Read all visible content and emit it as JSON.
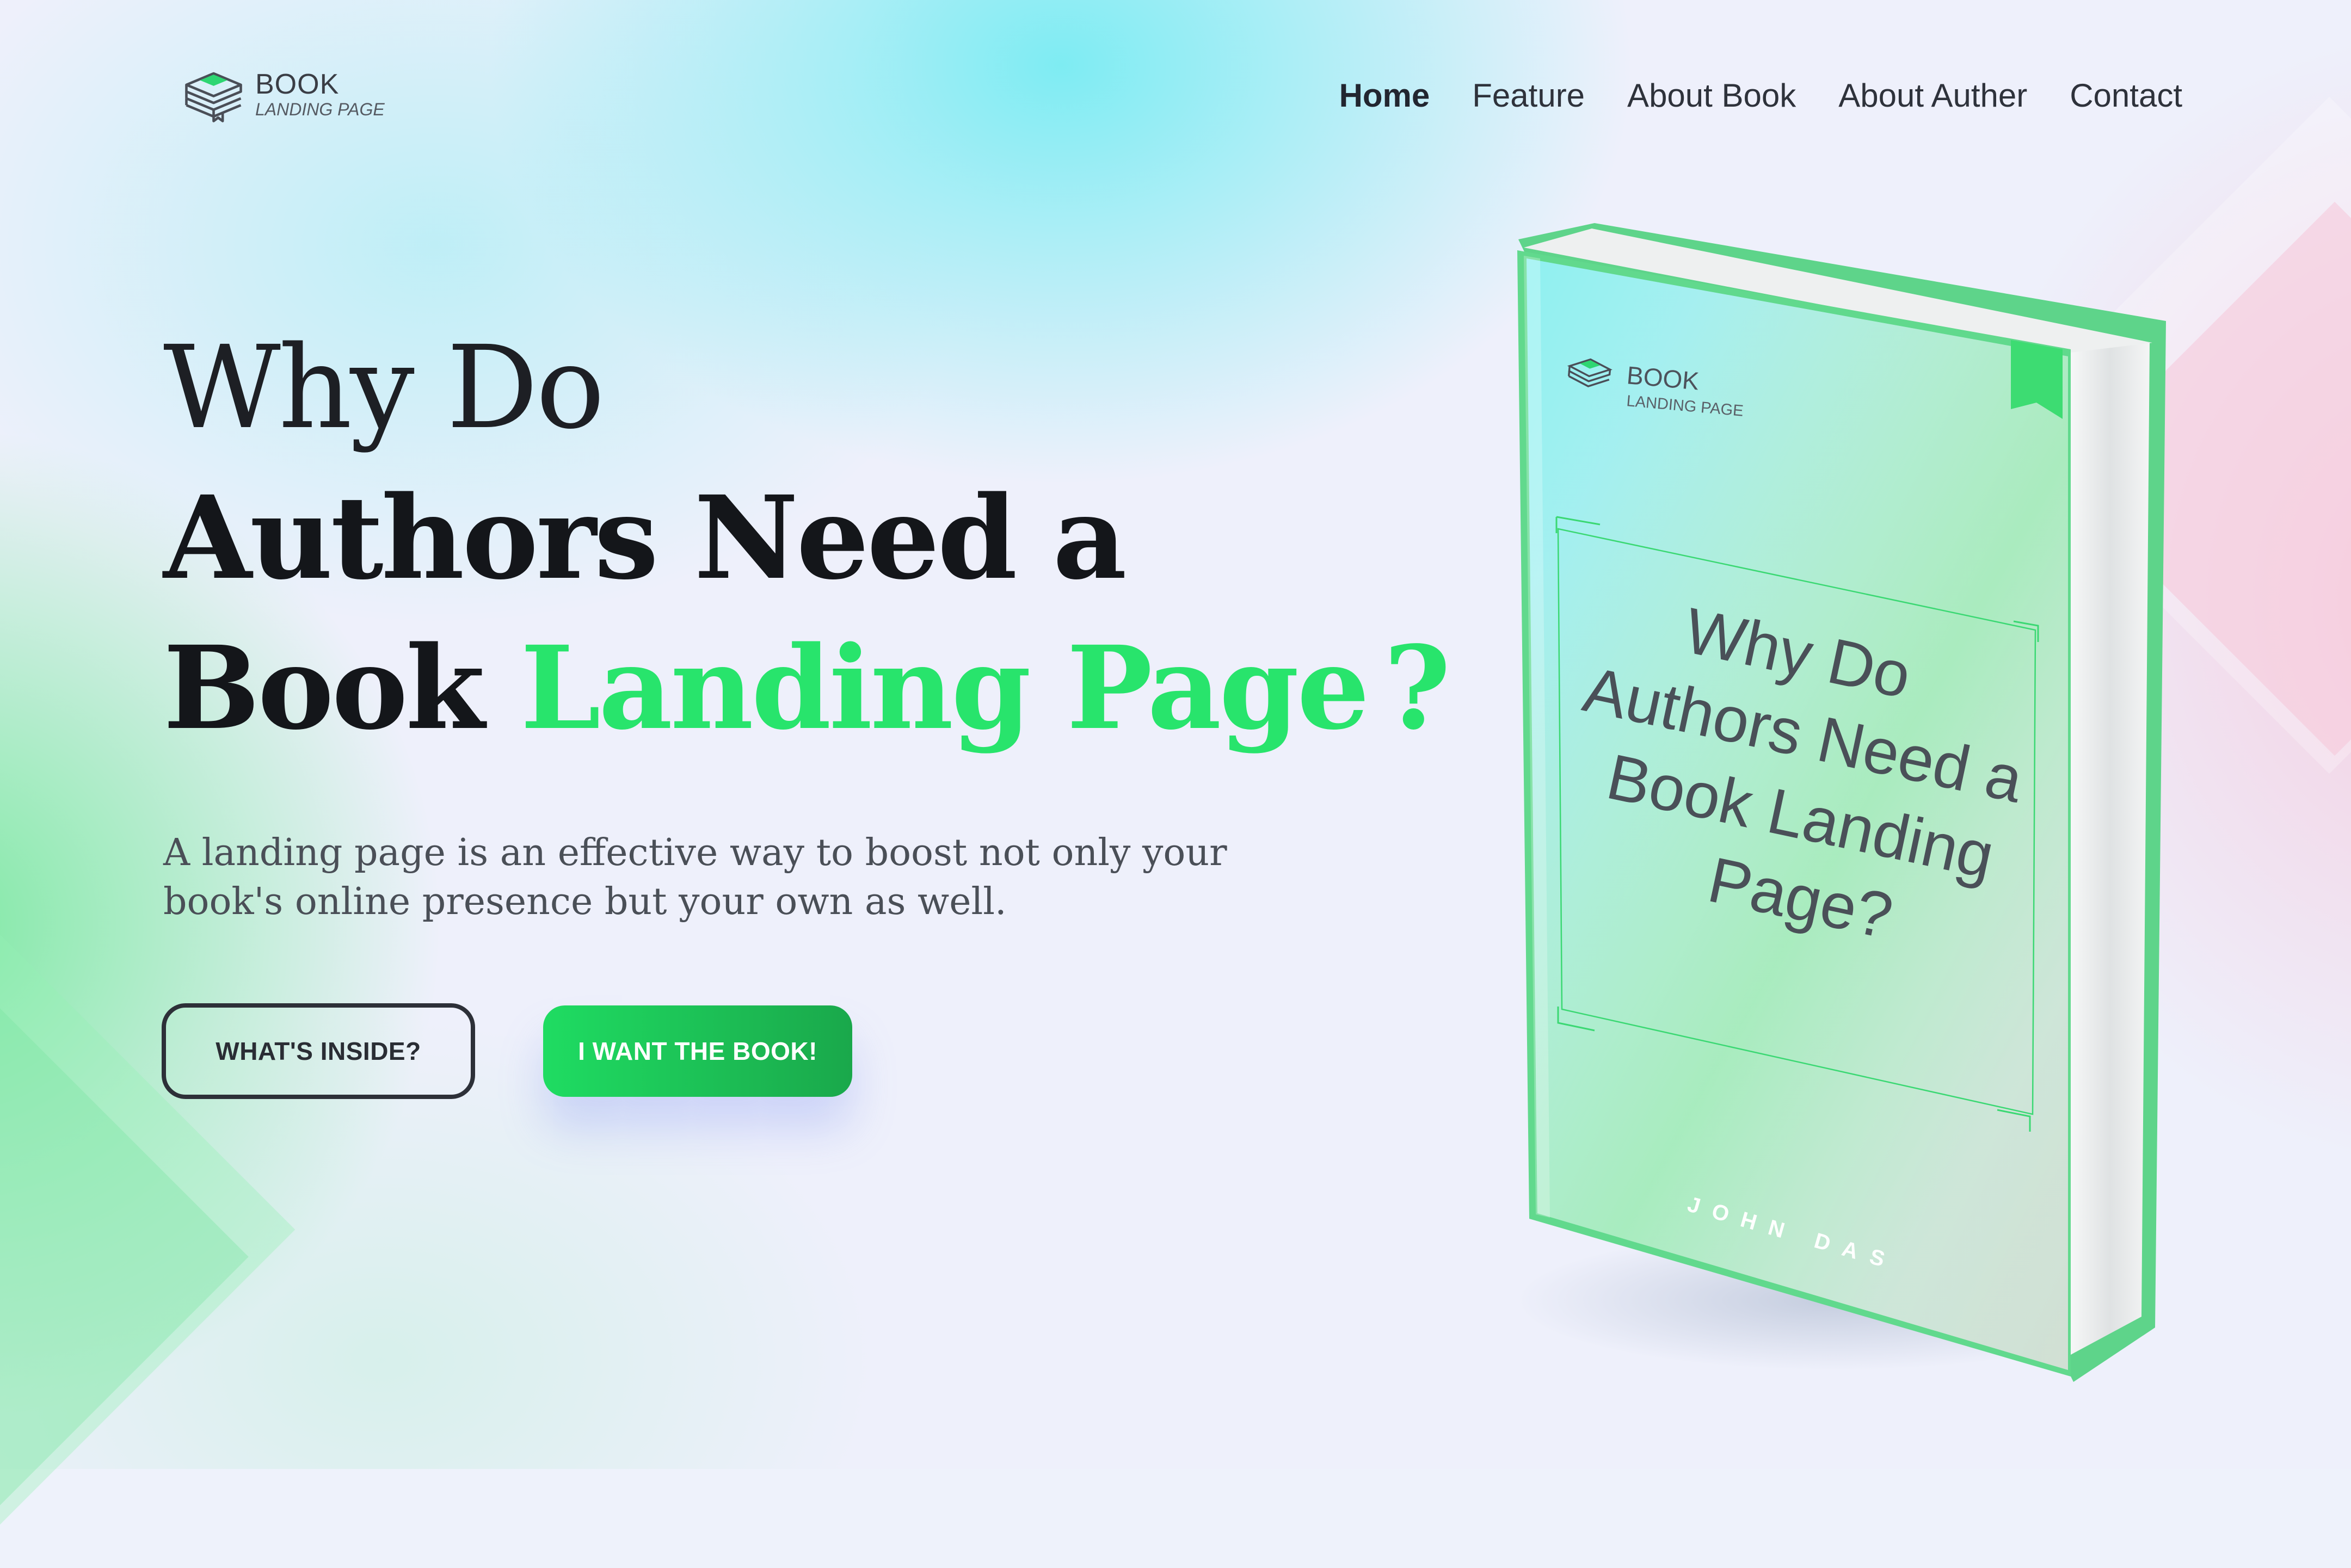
{
  "logo": {
    "title": "BOOK",
    "subtitle": "LANDING PAGE",
    "icon": "stacked-books-icon"
  },
  "nav": {
    "items": [
      {
        "label": "Home",
        "active": true
      },
      {
        "label": "Feature",
        "active": false
      },
      {
        "label": "About Book",
        "active": false
      },
      {
        "label": "About Auther",
        "active": false
      },
      {
        "label": "Contact",
        "active": false
      }
    ]
  },
  "hero": {
    "line1": "Why Do",
    "line2": "Authors Need a",
    "line3_plain": "Book",
    "line3_accent": "Landing Page",
    "line3_mark": "?",
    "tagline": "A landing page is an effective way to boost not only your book's online presence but your own as well.",
    "secondary_button": "WHAT'S INSIDE?",
    "primary_button": "I WANT THE BOOK!"
  },
  "book": {
    "cover_logo_title": "BOOK",
    "cover_logo_subtitle": "LANDING PAGE",
    "cover_lines": [
      "Why Do",
      "Authors Need a",
      "Book Landing",
      "Page?"
    ],
    "author": "JOHN DAS"
  },
  "colors": {
    "accent": "#28e46c",
    "button_gradient_start": "#1fdc62",
    "button_gradient_end": "#1aa84b",
    "text_dark": "#14161a",
    "book_spine": "#5ed48a"
  }
}
